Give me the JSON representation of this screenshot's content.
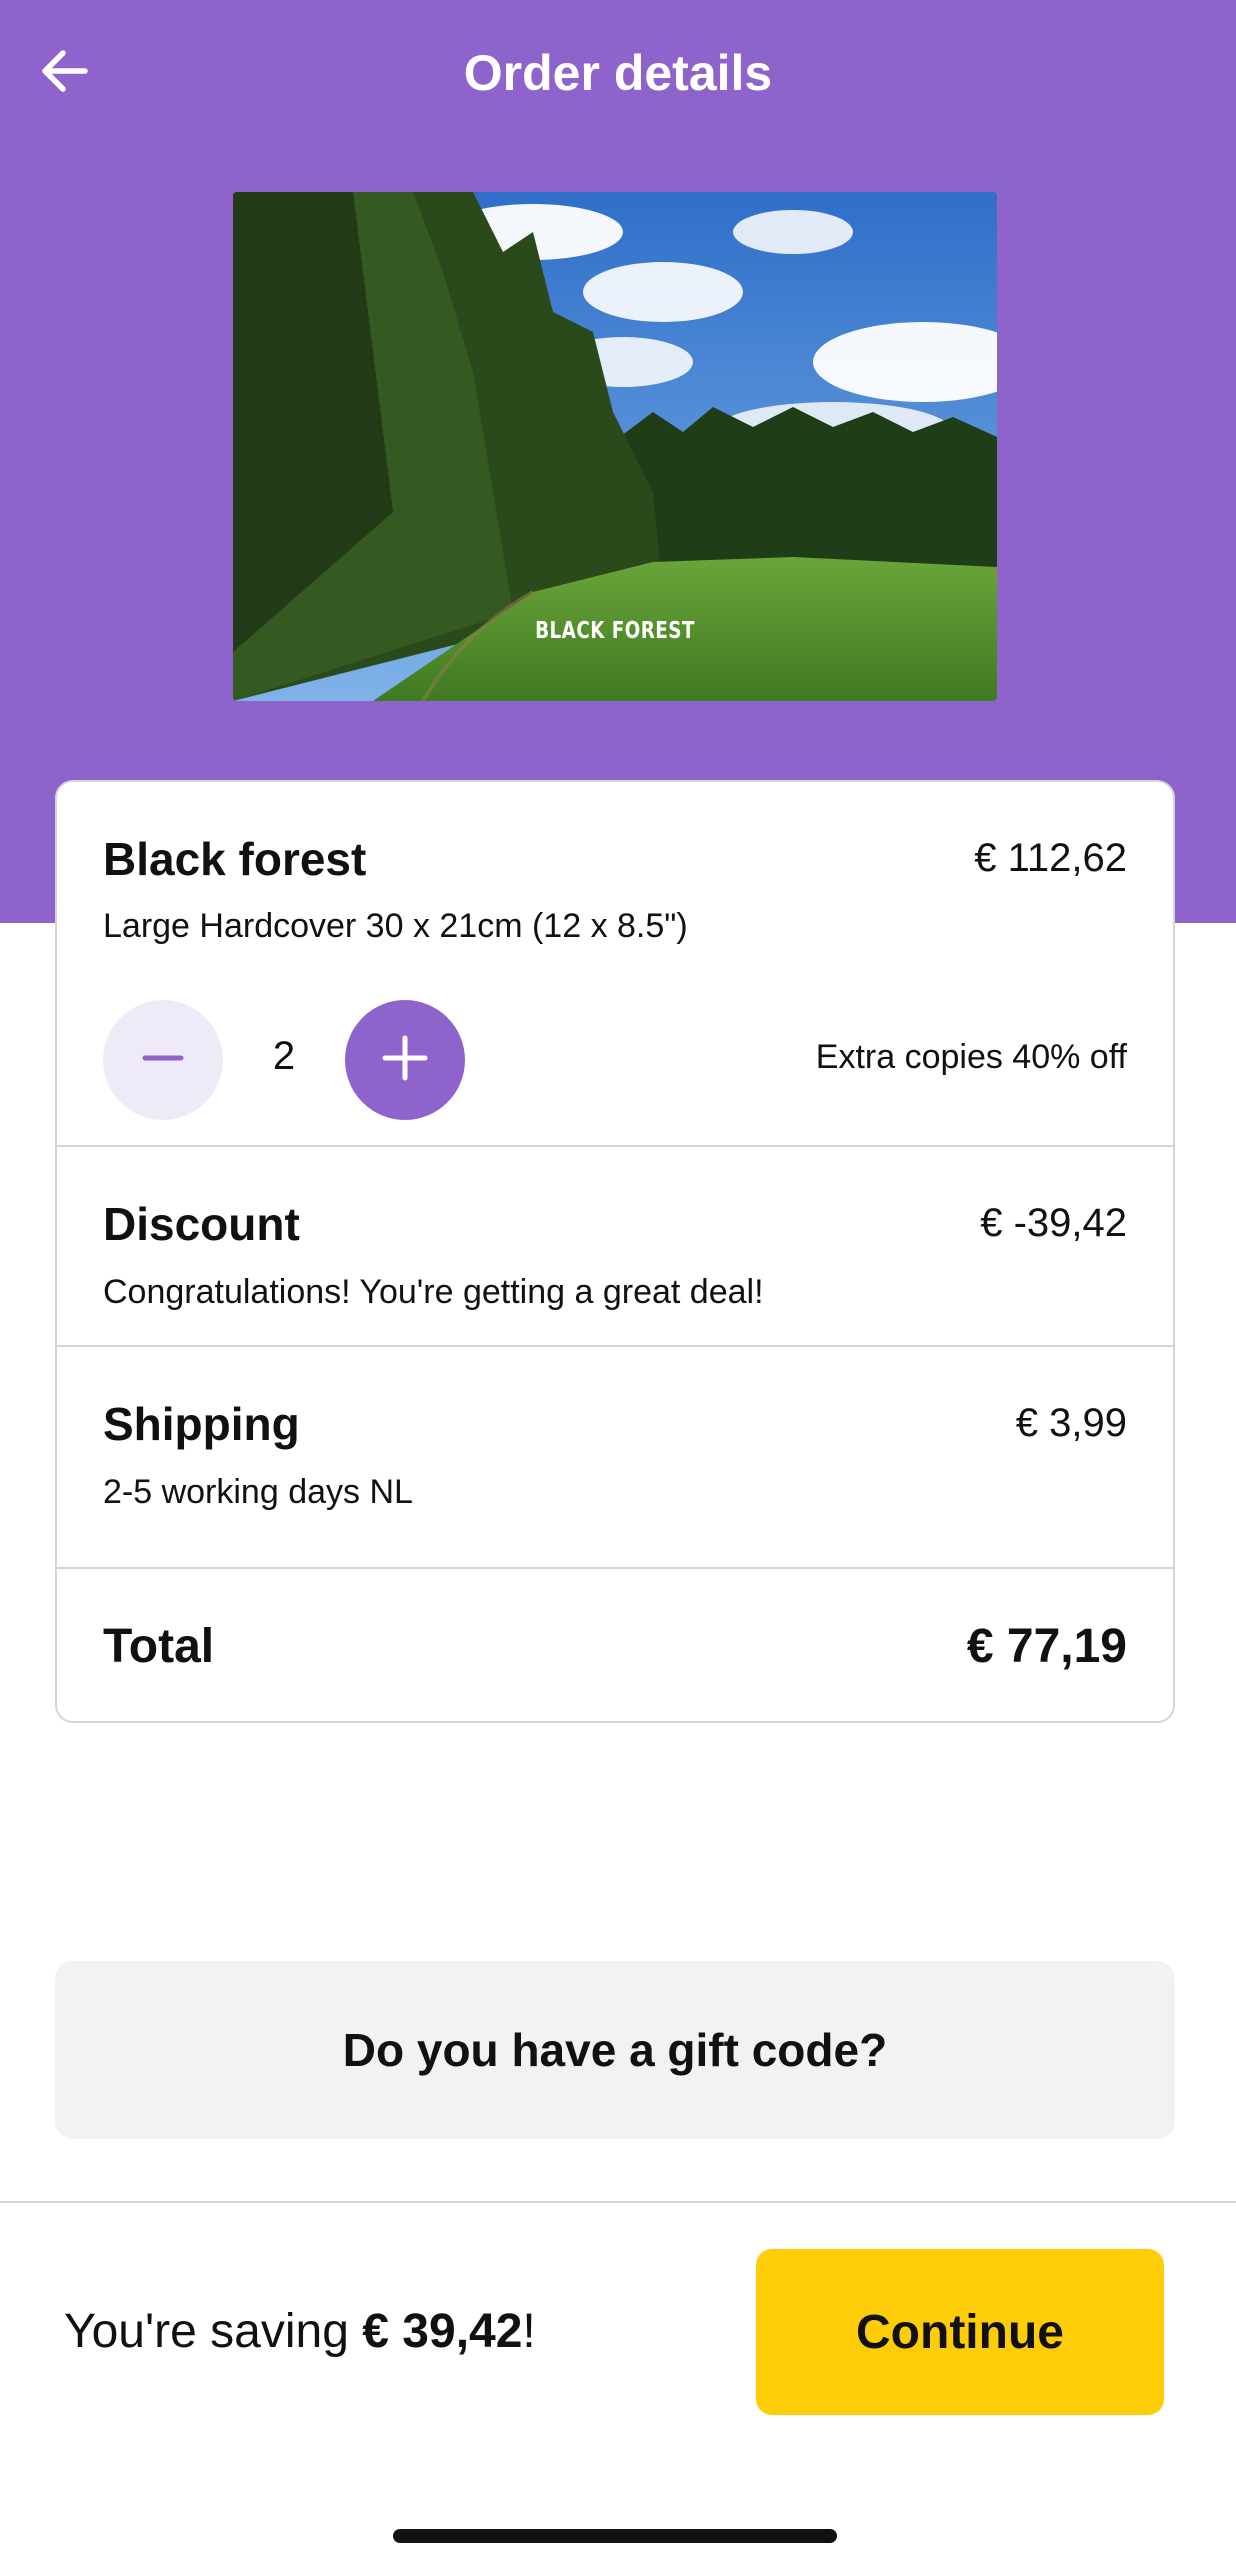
{
  "header": {
    "title": "Order details",
    "back_icon": "arrow-left-icon"
  },
  "cover": {
    "label": "BLACK FOREST"
  },
  "product": {
    "title": "Black forest",
    "price": "€ 112,62",
    "format": "Large Hardcover 30 x 21cm (12 x 8.5\")",
    "quantity": "2",
    "extra_copies_note": "Extra copies 40% off",
    "minus_icon": "minus-icon",
    "plus_icon": "plus-icon"
  },
  "discount": {
    "title": "Discount",
    "amount": "€ -39,42",
    "note": "Congratulations! You're getting a great deal!"
  },
  "shipping": {
    "title": "Shipping",
    "amount": "€ 3,99",
    "note": "2-5 working days NL"
  },
  "total": {
    "label": "Total",
    "amount": "€ 77,19"
  },
  "gift_code": {
    "label": "Do you have a gift code?"
  },
  "footer": {
    "saving_prefix": "You're saving ",
    "saving_amount": "€ 39,42",
    "saving_suffix": "!",
    "continue_label": "Continue"
  },
  "colors": {
    "brand_purple": "#8f63cc",
    "accent_yellow": "#ffcd08",
    "light_purple": "#efeaf8",
    "gift_bg": "#f2f2f0"
  }
}
